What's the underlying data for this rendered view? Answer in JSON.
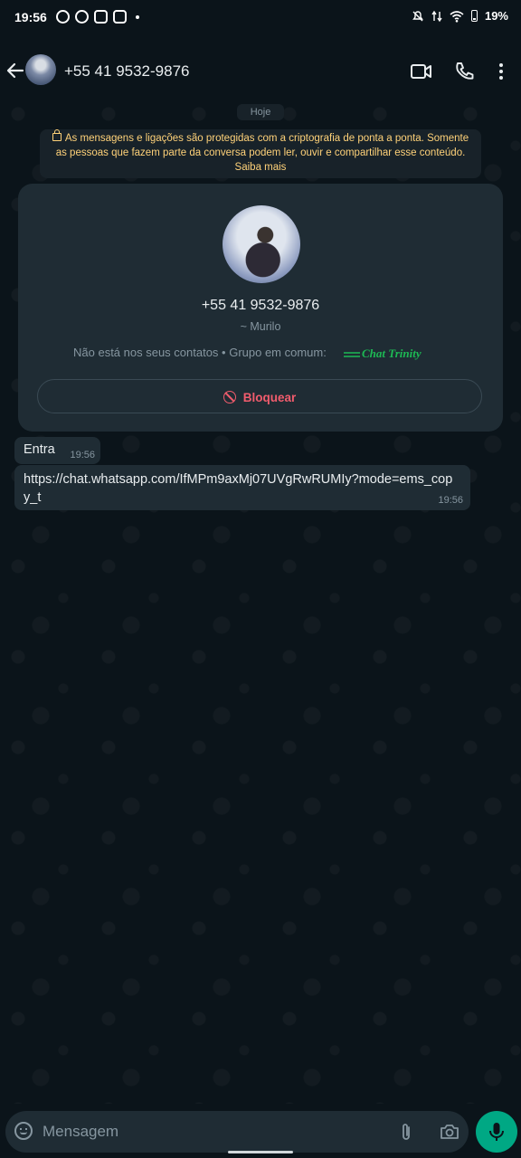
{
  "status_bar": {
    "time": "19:56",
    "battery": "19%",
    "notification_icons": [
      "whatsapp-icon",
      "whatsapp-icon",
      "instagram-icon",
      "instagram-icon"
    ]
  },
  "header": {
    "contact_title": "+55 41 9532-9876",
    "icons": [
      "back-arrow-icon",
      "video-call-icon",
      "phone-icon",
      "more-vert-icon"
    ]
  },
  "chat": {
    "date_chip": "Hoje",
    "encryption_notice": "As mensagens e ligações são protegidas com a criptografia de ponta a ponta. Somente as pessoas que fazem parte da conversa podem ler, ouvir e compartilhar esse conteúdo. Saiba mais",
    "contact_card": {
      "phone": "+55 41 9532-9876",
      "push_name": "~ Murilo",
      "info": "Não está nos seus contatos • Grupo em comum:",
      "group_logo_text": "Chat Trinity",
      "block_label": "Bloquear"
    },
    "messages": [
      {
        "text": "Entra",
        "time": "19:56"
      },
      {
        "text": "https://chat.whatsapp.com/IfMPm9axMj07UVgRwRUMIy?mode=ems_copy_t",
        "time": "19:56"
      }
    ]
  },
  "composer": {
    "placeholder": "Mensagem"
  },
  "colors": {
    "background": "#0b141a",
    "bubble": "#1f2c34",
    "notice_text": "#ffd279",
    "danger": "#f15c6d",
    "accent": "#00a884"
  }
}
